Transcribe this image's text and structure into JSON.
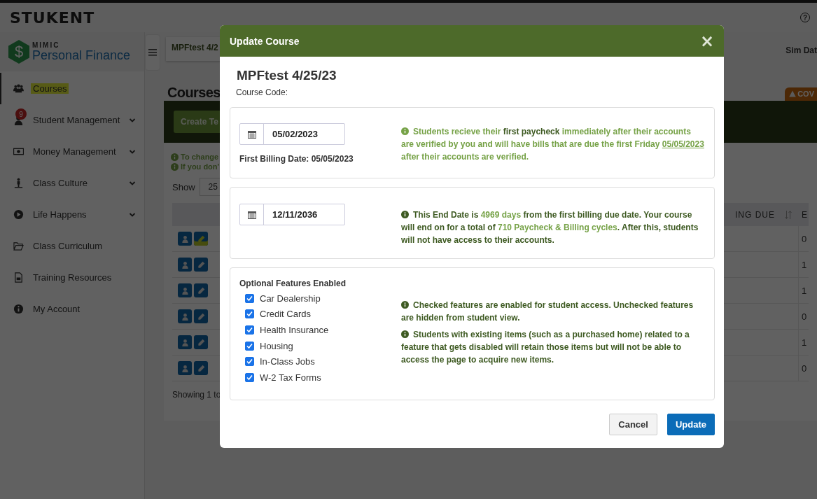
{
  "top_bar": {
    "brand": "STUKENT",
    "help": "?"
  },
  "product": {
    "small": "MIMIC",
    "name": "Personal Finance",
    "symbol": "$"
  },
  "sidebar": {
    "items": [
      {
        "label": "Courses",
        "selected": true,
        "marker": true
      },
      {
        "label": "Student Management",
        "selected": false,
        "submenu": true,
        "badge": "9"
      },
      {
        "label": "Money Management",
        "selected": false,
        "submenu": true
      },
      {
        "label": "Class Culture",
        "selected": false,
        "submenu": true
      },
      {
        "label": "Life Happens",
        "selected": false,
        "submenu": true
      },
      {
        "label": "Class Curriculum",
        "selected": false
      },
      {
        "label": "Training Resources",
        "selected": false
      },
      {
        "label": "My Account",
        "selected": false
      }
    ]
  },
  "header": {
    "course_tab": "MPFtest 4/2",
    "sim_date": "Sim Dat"
  },
  "main": {
    "title": "Courses",
    "alert": "COV",
    "create_button": "Create Te",
    "notes": [
      "To change",
      "If you don'"
    ],
    "show_label": "Show",
    "show_value": "25",
    "table": {
      "columns": [
        "ING DUE",
        "E"
      ],
      "rows": [
        {
          "column_2": "0",
          "marker": true
        },
        {
          "column_2": "1",
          "marker": false
        },
        {
          "column_2": "1",
          "marker": false
        },
        {
          "column_2": "0",
          "marker": false
        },
        {
          "column_2": "1",
          "marker": false
        },
        {
          "column_2": "0",
          "marker": false
        }
      ]
    },
    "footer": "Showing 1 to"
  },
  "modal": {
    "title": "Update Course",
    "close": "×",
    "course_name": "MPFtest 4/25/23",
    "course_code_label": "Course Code:",
    "sections": [
      {
        "kind": "start",
        "date": "05/02/2023",
        "billing_label": "First Billing Date:",
        "billing_value": "05/05/2023",
        "note": [
          {
            "text": "Students recieve their ",
            "kind": "light"
          },
          {
            "text": "first paycheck",
            "kind": "dark"
          },
          {
            "text": " immediately after their accounts are verified by you and will have bills that are due the first Friday ",
            "kind": "light"
          },
          {
            "text": "05/05/2023",
            "kind": "link"
          },
          {
            "text": " after their accounts are verified.",
            "kind": "light"
          }
        ]
      },
      {
        "kind": "end",
        "date": "12/11/2036",
        "note": [
          {
            "text": "This End Date is ",
            "kind": "dark"
          },
          {
            "text": "4969 days",
            "kind": "light"
          },
          {
            "text": " from the first billing due date. Your course will end on for a total of ",
            "kind": "dark"
          },
          {
            "text": "710 Paycheck & Billing cycles",
            "kind": "light"
          },
          {
            "text": ". After this, students will not have access to their accounts.",
            "kind": "dark"
          }
        ]
      },
      {
        "kind": "features",
        "heading": "Optional Features Enabled",
        "features": [
          {
            "label": "Car Dealership",
            "checked": true
          },
          {
            "label": "Credit Cards",
            "checked": true
          },
          {
            "label": "Health Insurance",
            "checked": true
          },
          {
            "label": "Housing",
            "checked": true
          },
          {
            "label": "In-Class Jobs",
            "checked": true
          },
          {
            "label": "W-2 Tax Forms",
            "checked": true
          }
        ],
        "notes": [
          "Checked features are enabled for student access. Unchecked features are hidden from student view.",
          "Students with existing items (such as a purchased home) related to a feature that gets disabled will retain those items but will not be able to access the page to acquire new items."
        ]
      }
    ],
    "buttons": [
      {
        "label": "Cancel",
        "kind": "secondary"
      },
      {
        "label": "Update",
        "kind": "primary"
      }
    ]
  }
}
